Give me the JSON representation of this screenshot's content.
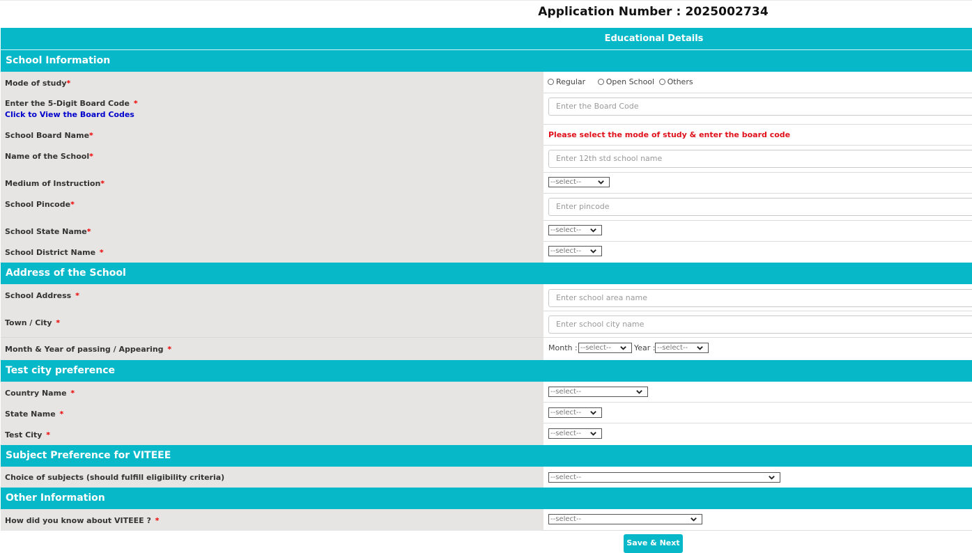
{
  "header": {
    "application_label": "Application Number : 2025002734",
    "main_title": "Educational Details"
  },
  "colors": {
    "accent": "#07b8c9",
    "label_bg": "#e6e5e4",
    "required": "#ee0000",
    "error": "#e0101a",
    "link": "#0000cc"
  },
  "sections": {
    "school_info": "School Information",
    "address": "Address of the School",
    "test_city": "Test city preference",
    "subject": "Subject Preference for VITEEE",
    "other": "Other Information"
  },
  "school_info": {
    "mode_label": "Mode of study",
    "mode_options": [
      "Regular",
      "Open School",
      "Others"
    ],
    "board_code_label": "Enter the 5-Digit Board Code",
    "board_code_link": "Click to View the Board Codes",
    "board_code_placeholder": "Enter the Board Code",
    "board_name_label": "School Board Name",
    "board_name_error": "Please select the mode of study & enter the board code",
    "school_name_label": "Name of the School",
    "school_name_placeholder": "Enter 12th std school name",
    "medium_label": "Medium of Instruction",
    "medium_value": "--select--",
    "pincode_label": "School Pincode",
    "pincode_placeholder": "Enter pincode",
    "state_label": "School State Name",
    "state_value": "--select--",
    "district_label": "School District Name",
    "district_value": "--select--"
  },
  "address": {
    "address_label": "School Address",
    "address_placeholder": "Enter school area name",
    "city_label": "Town / City",
    "city_placeholder": "Enter school city name",
    "passing_label": "Month & Year of passing / Appearing",
    "month_label": "Month :",
    "month_value": "--select--",
    "year_label": "Year :",
    "year_value": "--select--"
  },
  "test_city": {
    "country_label": "Country Name",
    "country_value": "--select--",
    "state_label": "State Name",
    "state_value": "--select--",
    "city_label": "Test City",
    "city_value": "--select--"
  },
  "subject": {
    "choice_label": "Choice of subjects (should fulfill eligibility criteria)",
    "choice_value": "--select--"
  },
  "other": {
    "source_label": "How did you know about VITEEE ?",
    "source_value": "--select--"
  },
  "required_mark": "*",
  "actions": {
    "save_next": "Save & Next"
  }
}
